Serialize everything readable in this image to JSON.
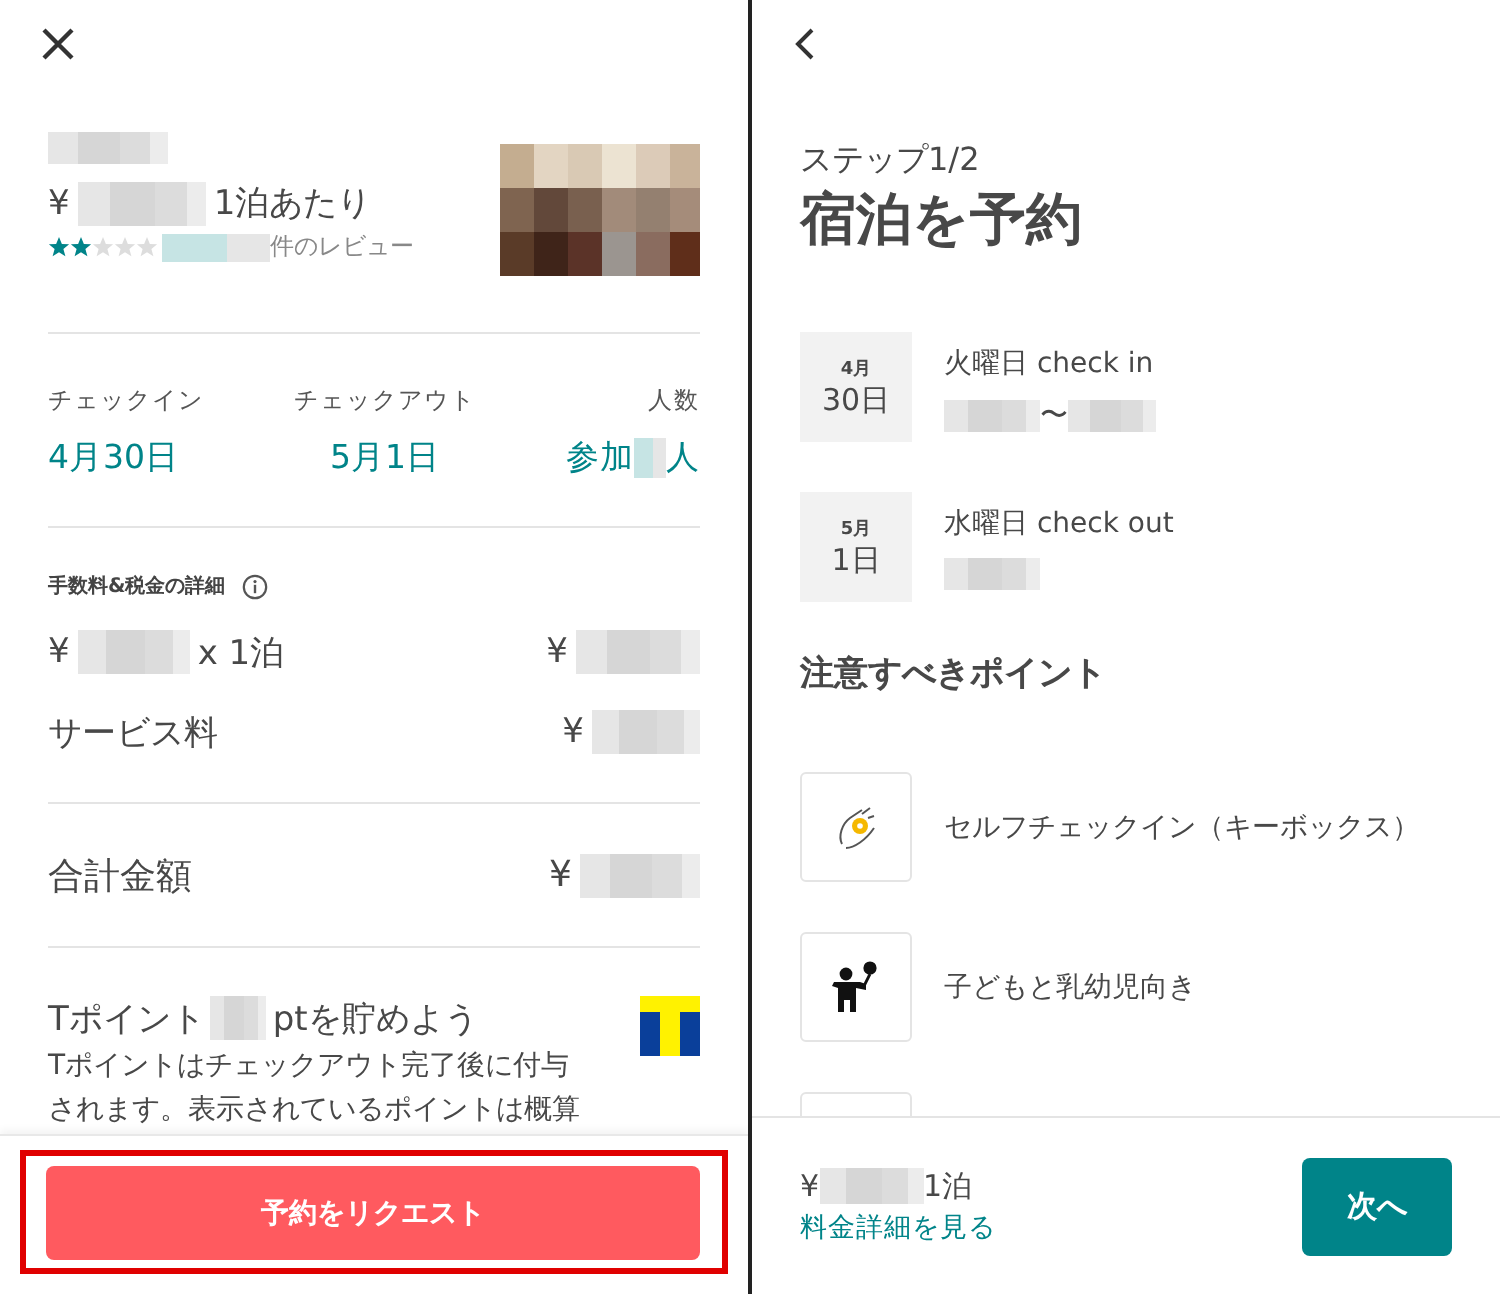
{
  "summary_panel": {
    "listing": {
      "currency": "¥",
      "price_suffix": "1泊あたり",
      "stars": 2,
      "reviews_suffix": "件のレビュー"
    },
    "trip": [
      {
        "label": "チェックイン",
        "value": "4月30日"
      },
      {
        "label": "チェックアウト",
        "value": "5月1日"
      },
      {
        "label": "人数",
        "value": "参加",
        "suffix": "人"
      }
    ],
    "fees": {
      "title": "手数料&税金の詳細",
      "rows": [
        {
          "kind": "nightly",
          "currency": "¥",
          "suffix": "x 1泊",
          "amount": "¥"
        },
        {
          "kind": "service",
          "label": "サービス料",
          "amount": "¥"
        }
      ]
    },
    "total": {
      "label": "合計金額",
      "amount": "¥"
    },
    "tpoint": {
      "title_prefix": "Tポイント",
      "title_suffix": "ptを貯めよう",
      "description": "Tポイントはチェックアウト完了後に付与されます。表示されているポイントは概算"
    },
    "request_button": "予約をリクエスト"
  },
  "booking_panel": {
    "step": "ステップ1/2",
    "title": "宿泊を予約",
    "dates": [
      {
        "month": "4月",
        "day": "30日",
        "heading": "火曜日 check in",
        "separator": "〜"
      },
      {
        "month": "5月",
        "day": "1日",
        "heading": "水曜日 check out"
      }
    ],
    "points_title": "注意すべきポイント",
    "points": [
      {
        "kind": "self_checkin",
        "label": "セルフチェックイン（キーボックス）"
      },
      {
        "kind": "family",
        "label": "子どもと乳幼児向き"
      },
      {
        "kind": "clipped"
      }
    ],
    "footer": {
      "currency": "¥",
      "price_suffix": "1泊",
      "link": "料金詳細を見る",
      "next_button": "次へ"
    }
  }
}
